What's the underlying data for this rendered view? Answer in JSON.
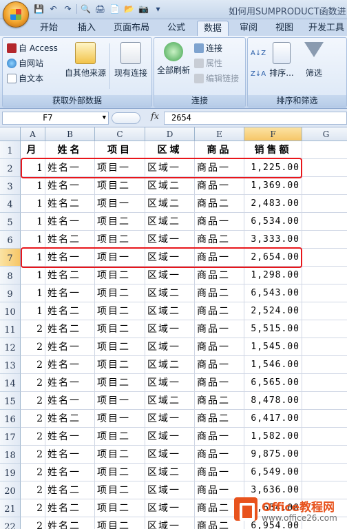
{
  "window": {
    "title": "如何用SUMPRODUCT函数进"
  },
  "tabs": [
    "开始",
    "插入",
    "页面布局",
    "公式",
    "数据",
    "审阅",
    "视图",
    "开发工具"
  ],
  "active_tab": "数据",
  "ribbon": {
    "get_external": {
      "access": "自 Access",
      "web": "自网站",
      "text": "自文本",
      "other": "自其他来源",
      "existing": "现有连接",
      "label": "获取外部数据"
    },
    "connections": {
      "refresh_all": "全部刷新",
      "connections": "连接",
      "properties": "属性",
      "edit_links": "编辑链接",
      "label": "连接"
    },
    "sort_filter": {
      "sort": "排序...",
      "filter": "筛选",
      "label": "排序和筛选"
    }
  },
  "formula_bar": {
    "name_box": "F7",
    "fx": "fx",
    "value": "2654"
  },
  "columns": [
    "A",
    "B",
    "C",
    "D",
    "E",
    "F",
    "G"
  ],
  "header_row": [
    "月",
    "姓名",
    "项目",
    "区域",
    "商品",
    "销售额"
  ],
  "rows": [
    [
      "1",
      "姓名一",
      "项目一",
      "区域一",
      "商品一",
      "1,225.00"
    ],
    [
      "1",
      "姓名一",
      "项目二",
      "区域二",
      "商品一",
      "1,369.00"
    ],
    [
      "1",
      "姓名二",
      "项目一",
      "区域二",
      "商品二",
      "2,483.00"
    ],
    [
      "1",
      "姓名一",
      "项目二",
      "区域二",
      "商品一",
      "6,534.00"
    ],
    [
      "1",
      "姓名二",
      "项目二",
      "区域一",
      "商品二",
      "3,333.00"
    ],
    [
      "1",
      "姓名一",
      "项目一",
      "区域一",
      "商品一",
      "2,654.00"
    ],
    [
      "1",
      "姓名二",
      "项目二",
      "区域一",
      "商品二",
      "1,298.00"
    ],
    [
      "1",
      "姓名一",
      "项目二",
      "区域二",
      "商品二",
      "6,543.00"
    ],
    [
      "1",
      "姓名二",
      "项目二",
      "区域二",
      "商品二",
      "2,524.00"
    ],
    [
      "2",
      "姓名二",
      "项目二",
      "区域一",
      "商品一",
      "5,515.00"
    ],
    [
      "2",
      "姓名一",
      "项目二",
      "区域一",
      "商品一",
      "1,545.00"
    ],
    [
      "2",
      "姓名一",
      "项目二",
      "区域二",
      "商品一",
      "1,546.00"
    ],
    [
      "2",
      "姓名一",
      "项目二",
      "区域一",
      "商品一",
      "6,565.00"
    ],
    [
      "2",
      "姓名一",
      "项目一",
      "区域二",
      "商品二",
      "8,478.00"
    ],
    [
      "2",
      "姓名二",
      "项目一",
      "区域一",
      "商品二",
      "6,417.00"
    ],
    [
      "2",
      "姓名一",
      "项目二",
      "区域一",
      "商品一",
      "1,582.00"
    ],
    [
      "2",
      "姓名一",
      "项目二",
      "区域一",
      "商品一",
      "9,875.00"
    ],
    [
      "2",
      "姓名一",
      "项目二",
      "区域二",
      "商品一",
      "6,549.00"
    ],
    [
      "2",
      "姓名二",
      "项目二",
      "区域一",
      "商品一",
      "3,636.00"
    ],
    [
      "2",
      "姓名二",
      "项目二",
      "区域一",
      "商品二",
      "3,654.00"
    ],
    [
      "2",
      "姓名二",
      "项目二",
      "区域一",
      "商品二",
      "6,954.00"
    ]
  ],
  "selected_cell": "F7",
  "highlighted_rows": [
    2,
    7
  ],
  "watermark": {
    "title": "Office教程网",
    "url": "www.office26.com"
  }
}
